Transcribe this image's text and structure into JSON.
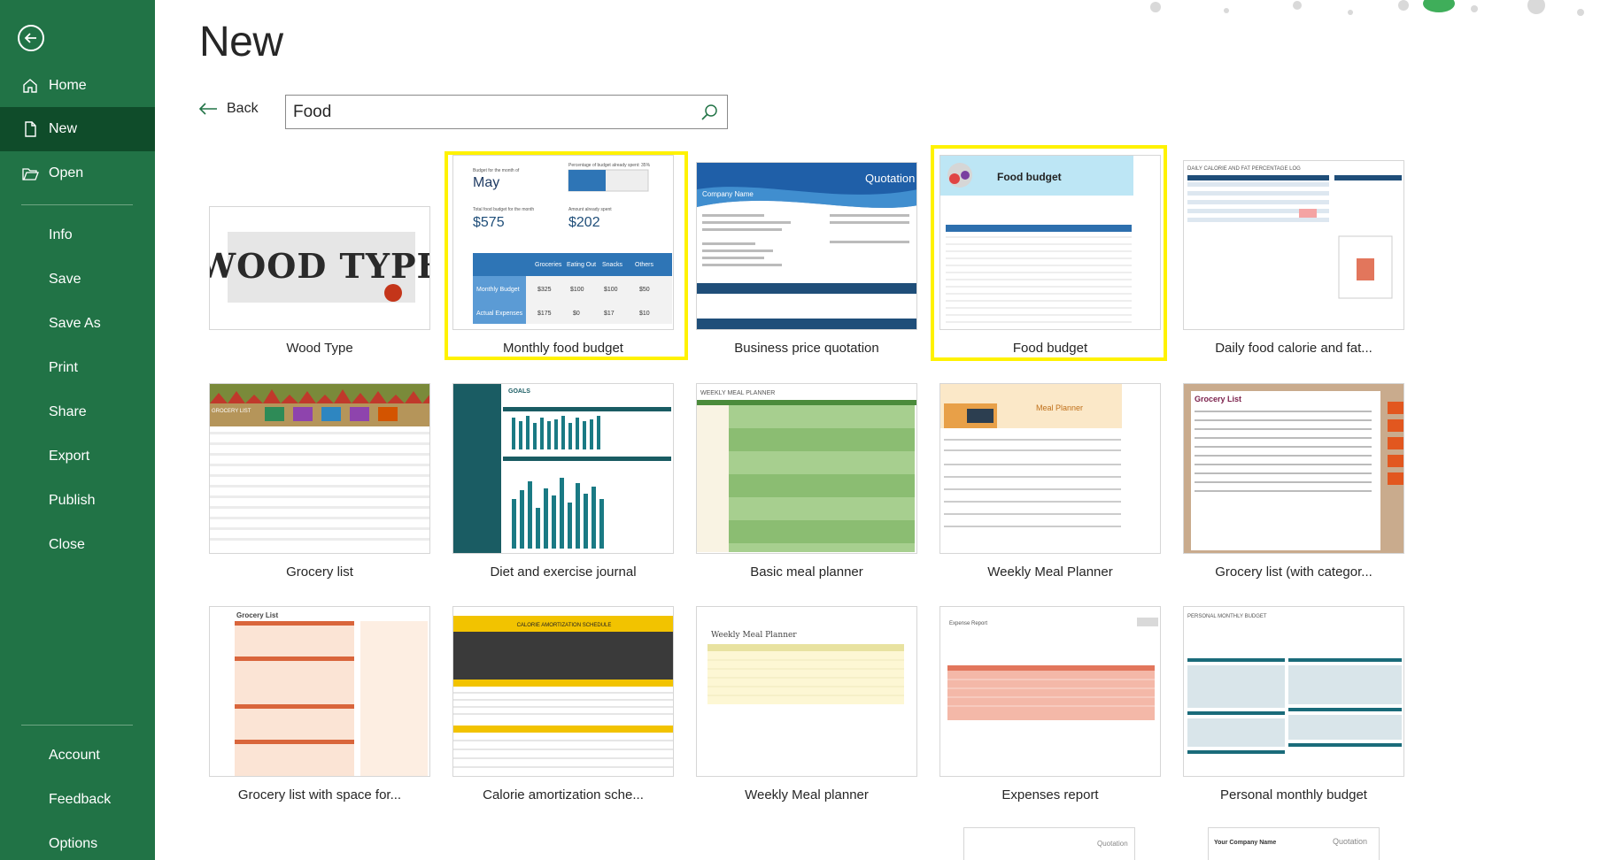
{
  "sidebar": {
    "items": [
      {
        "label": "Home",
        "icon": "home-icon"
      },
      {
        "label": "New",
        "icon": "new-document-icon",
        "selected": true
      },
      {
        "label": "Open",
        "icon": "folder-open-icon"
      },
      {
        "label": "Info"
      },
      {
        "label": "Save"
      },
      {
        "label": "Save As"
      },
      {
        "label": "Print"
      },
      {
        "label": "Share"
      },
      {
        "label": "Export"
      },
      {
        "label": "Publish"
      },
      {
        "label": "Close"
      },
      {
        "label": "Account"
      },
      {
        "label": "Feedback"
      },
      {
        "label": "Options"
      }
    ],
    "accent_color": "#217346",
    "selected_color": "#0f4c2a"
  },
  "header": {
    "title": "New",
    "back_label": "Back"
  },
  "search": {
    "value": "Food"
  },
  "templates": [
    {
      "label": "Wood Type",
      "thumb_text": "WOOD TYPE"
    },
    {
      "label": "Monthly food budget",
      "highlighted": true,
      "thumb_text": {
        "month": "May",
        "budget": "$575",
        "spent": "$202",
        "cols": [
          "Groceries",
          "Eating Out",
          "Snacks",
          "Others"
        ],
        "row1": [
          "Monthly Budget",
          "$325",
          "$100",
          "$100",
          "$50"
        ],
        "row2": [
          "Actual Expenses",
          "$175",
          "$0",
          "$17",
          "$10"
        ]
      }
    },
    {
      "label": "Business price quotation",
      "thumb_text": {
        "heading": "Quotation",
        "company": "Company Name"
      }
    },
    {
      "label": "Food budget",
      "highlighted": true,
      "thumb_text": {
        "heading": "Food budget"
      }
    },
    {
      "label": "Daily food calorie and fat...",
      "thumb_text": {
        "heading": "DAILY CALORIE AND FAT PERCENTAGE LOG"
      }
    },
    {
      "label": "Grocery list",
      "thumb_text": {
        "heading": "GROCERY LIST"
      }
    },
    {
      "label": "Diet and exercise journal",
      "thumb_text": {
        "heading": "GOALS"
      }
    },
    {
      "label": "Basic meal planner",
      "thumb_text": {
        "heading": "WEEKLY MEAL PLANNER"
      }
    },
    {
      "label": "Weekly Meal Planner",
      "thumb_text": {
        "heading": "Meal Planner"
      }
    },
    {
      "label": "Grocery list (with categor...",
      "thumb_text": {
        "heading": "Grocery List"
      }
    },
    {
      "label": "Grocery list with space for...",
      "thumb_text": {
        "heading": "Grocery List"
      }
    },
    {
      "label": "Calorie amortization sche...",
      "thumb_text": {
        "heading": "CALORIE AMORTIZATION SCHEDULE"
      }
    },
    {
      "label": "Weekly Meal planner",
      "thumb_text": {
        "heading": "Weekly Meal Planner"
      }
    },
    {
      "label": "Expenses report",
      "thumb_text": {
        "heading": "Expense Report"
      }
    },
    {
      "label": "Personal monthly budget",
      "thumb_text": {
        "heading": "PERSONAL MONTHLY BUDGET"
      }
    },
    {
      "label": "",
      "thumb_text": {
        "heading": "Quotation"
      }
    },
    {
      "label": "",
      "thumb_text": {
        "heading": "Quotation",
        "company": "Your Company Name"
      }
    }
  ],
  "colors": {
    "highlight": "#fff200",
    "excel_green": "#217346"
  }
}
